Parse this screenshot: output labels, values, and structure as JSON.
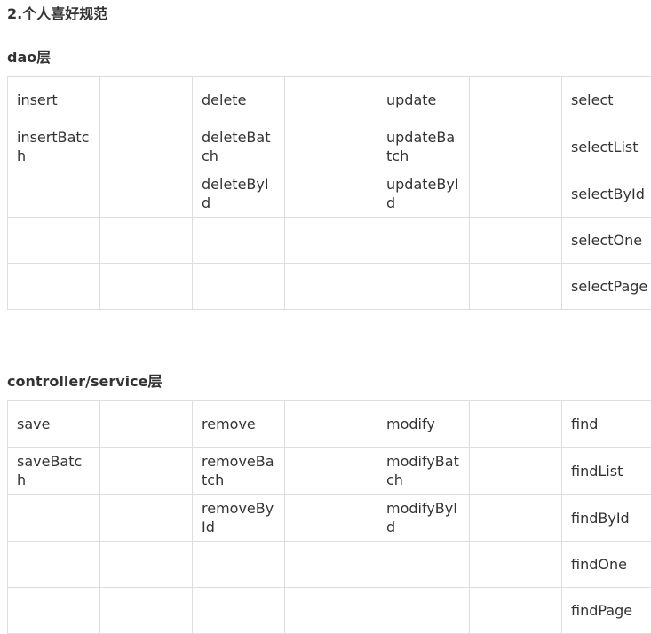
{
  "headings": {
    "top": "2.个人喜好规范",
    "dao": "dao层",
    "controller": "controller/service层"
  },
  "dao_table": {
    "rows": [
      [
        "insert",
        "",
        "delete",
        "",
        "update",
        "",
        "select"
      ],
      [
        "insertBatch",
        "",
        "deleteBatch",
        "",
        "updateBatch",
        "",
        "selectList"
      ],
      [
        "",
        "",
        "deleteById",
        "",
        "updateById",
        "",
        "selectById"
      ],
      [
        "",
        "",
        "",
        "",
        "",
        "",
        "selectOne"
      ],
      [
        "",
        "",
        "",
        "",
        "",
        "",
        "selectPage"
      ]
    ]
  },
  "controller_table": {
    "rows": [
      [
        "save",
        "",
        "remove",
        "",
        "modify",
        "",
        "find"
      ],
      [
        "saveBatch",
        "",
        "removeBatch",
        "",
        "modifyBatch",
        "",
        "findList"
      ],
      [
        "",
        "",
        "removeById",
        "",
        "modifyById",
        "",
        "findById"
      ],
      [
        "",
        "",
        "",
        "",
        "",
        "",
        "findOne"
      ],
      [
        "",
        "",
        "",
        "",
        "",
        "",
        "findPage"
      ]
    ]
  }
}
